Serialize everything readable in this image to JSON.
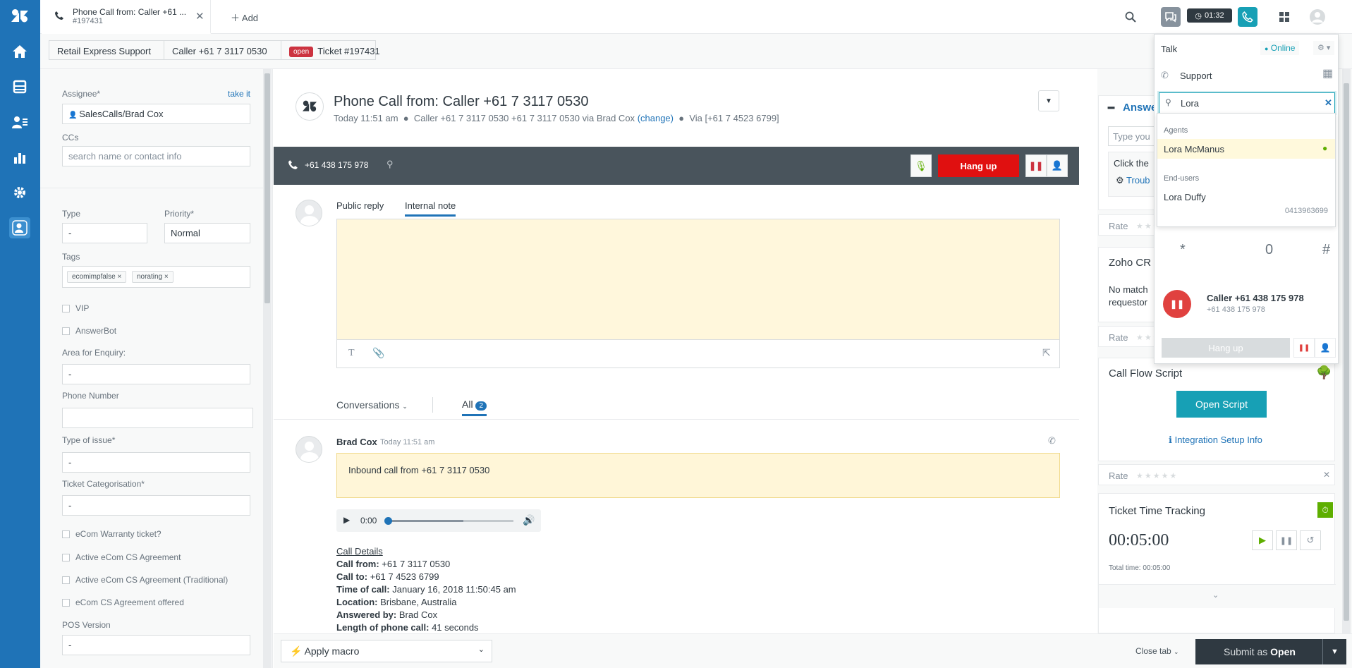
{
  "tab": {
    "title": "Phone Call from: Caller +61 ...",
    "subtitle": "#197431",
    "add_label": "Add"
  },
  "topbar": {
    "timer": "01:32"
  },
  "breadcrumbs": [
    "Retail Express Support",
    "Caller +61 7 3117 0530",
    "Ticket #197431"
  ],
  "status_badge": "open",
  "properties": {
    "assignee_label": "Assignee*",
    "take_it": "take it",
    "assignee_value": "SalesCalls/Brad Cox",
    "ccs_label": "CCs",
    "ccs_placeholder": "search name or contact info",
    "type_label": "Type",
    "type_value": "-",
    "priority_label": "Priority*",
    "priority_value": "Normal",
    "tags_label": "Tags",
    "tags": [
      "ecomimpfalse",
      "norating"
    ],
    "vip": "VIP",
    "answerbot": "AnswerBot",
    "area_label": "Area for Enquiry:",
    "area_value": "-",
    "phone_label": "Phone Number",
    "phone_value": "",
    "issue_label": "Type of issue*",
    "issue_value": "-",
    "categorisation_label": "Ticket Categorisation*",
    "categorisation_value": "-",
    "warranty": "eCom Warranty ticket?",
    "active_cs": "Active eCom CS Agreement",
    "active_cs_trad": "Active eCom CS Agreement (Traditional)",
    "cs_offered": "eCom CS Agreement offered",
    "pos_label": "POS Version",
    "pos_value": "-"
  },
  "ticket": {
    "title": "Phone Call from: Caller +61 7 3117 0530",
    "time": "Today 11:51 am",
    "caller_via": "Caller +61 7 3117 0530 +61 7 3117 0530 via Brad Cox",
    "change": "(change)",
    "via": "Via [+61 7 4523 6799]"
  },
  "callbar": {
    "number": "+61 438 175 978",
    "hangup": "Hang up"
  },
  "composer": {
    "public_reply": "Public reply",
    "internal_note": "Internal note"
  },
  "conversations": {
    "label": "Conversations",
    "all": "All",
    "count": "2"
  },
  "comment": {
    "author": "Brad Cox",
    "time": "Today 11:51 am",
    "note": "Inbound call from +61 7 3117 0530",
    "audio_time": "0:00",
    "details_title": "Call Details",
    "from_label": "Call from:",
    "from_value": "+61 7 3117 0530",
    "to_label": "Call to:",
    "to_value": "+61 7 4523 6799",
    "time_label": "Time of call:",
    "time_value": "January 16, 2018 11:50:45 am",
    "location_label": "Location:",
    "location_value": "Brisbane, Australia",
    "answered_label": "Answered by:",
    "answered_value": "Brad Cox",
    "length_label": "Length of phone call:",
    "length_value": "41 seconds"
  },
  "bottom": {
    "macro": "Apply macro",
    "close_tab": "Close tab",
    "submit_prefix": "Submit as",
    "submit_status": "Open"
  },
  "talk": {
    "title": "Talk",
    "status": "Online",
    "line": "Support",
    "search_value": "Lora",
    "agents_header": "Agents",
    "agent": "Lora McManus",
    "endusers_header": "End-users",
    "enduser": "Lora Duffy",
    "enduser_phone": "0413963699",
    "keys": [
      "*",
      "0",
      "#"
    ],
    "caller_name": "Caller +61 438 175 978",
    "caller_number": "+61 438 175 978",
    "hangup": "Hang up"
  },
  "apps": {
    "answer_partial": "Answe",
    "type_partial": "Type you",
    "click_partial": "Click the",
    "trouble_partial": "Troub",
    "rate": "Rate",
    "zoho_partial": "Zoho CR",
    "nomatch_partial": "No match",
    "requestor_partial": "requestor",
    "callflow_title": "Call Flow Script",
    "open_script": "Open Script",
    "integration": "Integration Setup Info",
    "tracking_title": "Ticket Time Tracking",
    "tracking_time": "00:05:00",
    "total_time": "Total time: 00:05:00"
  },
  "colors": {
    "nav": "#1f73b7",
    "hangup": "#e01010",
    "teal": "#17a0b5",
    "open": "#cc3340"
  }
}
